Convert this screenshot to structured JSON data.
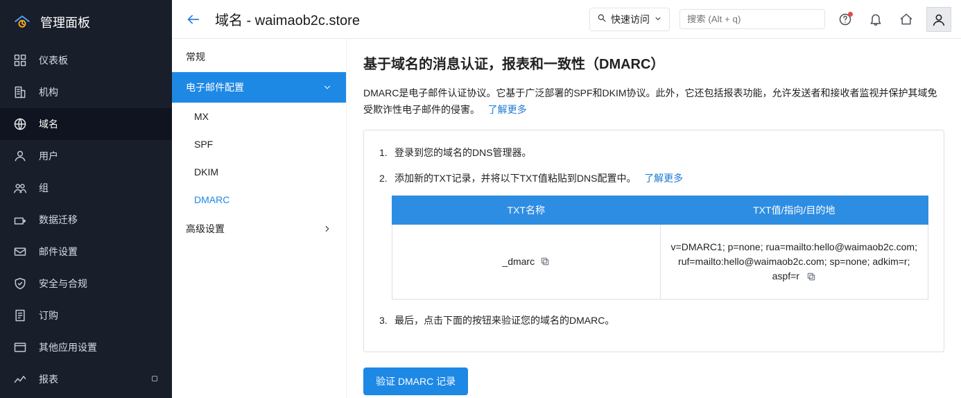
{
  "brand": {
    "title": "管理面板"
  },
  "sidebar": {
    "items": [
      {
        "label": "仪表板"
      },
      {
        "label": "机构"
      },
      {
        "label": "域名"
      },
      {
        "label": "用户"
      },
      {
        "label": "组"
      },
      {
        "label": "数据迁移"
      },
      {
        "label": "邮件设置"
      },
      {
        "label": "安全与合规"
      },
      {
        "label": "订购"
      },
      {
        "label": "其他应用设置"
      },
      {
        "label": "报表"
      }
    ]
  },
  "header": {
    "title": "域名 - waimaob2c.store",
    "quick_access_label": "快速访问",
    "search_placeholder": "搜索 (Alt + q)"
  },
  "subnav": {
    "general": "常规",
    "email_config": "电子邮件配置",
    "items": [
      {
        "label": "MX"
      },
      {
        "label": "SPF"
      },
      {
        "label": "DKIM"
      },
      {
        "label": "DMARC"
      }
    ],
    "advanced": "高级设置"
  },
  "page": {
    "heading": "基于域名的消息认证，报表和一致性（DMARC）",
    "lead": "DMARC是电子邮件认证协议。它基于广泛部署的SPF和DKIM协议。此外，它还包括报表功能，允许发送者和接收者监视并保护其域免受欺诈性电子邮件的侵害。",
    "learn_more": "了解更多",
    "steps": {
      "s1_num": "1.",
      "s1": "登录到您的域名的DNS管理器。",
      "s2_num": "2.",
      "s2": "添加新的TXT记录，并将以下TXT值粘贴到DNS配置中。",
      "s3_num": "3.",
      "s3": "最后，点击下面的按钮来验证您的域名的DMARC。"
    },
    "table": {
      "col1": "TXT名称",
      "col2": "TXT值/指向/目的地",
      "name": "_dmarc",
      "value": "v=DMARC1; p=none; rua=mailto:hello@waimaob2c.com; ruf=mailto:hello@waimaob2c.com; sp=none; adkim=r; aspf=r"
    },
    "verify_button": "验证 DMARC 记录"
  }
}
